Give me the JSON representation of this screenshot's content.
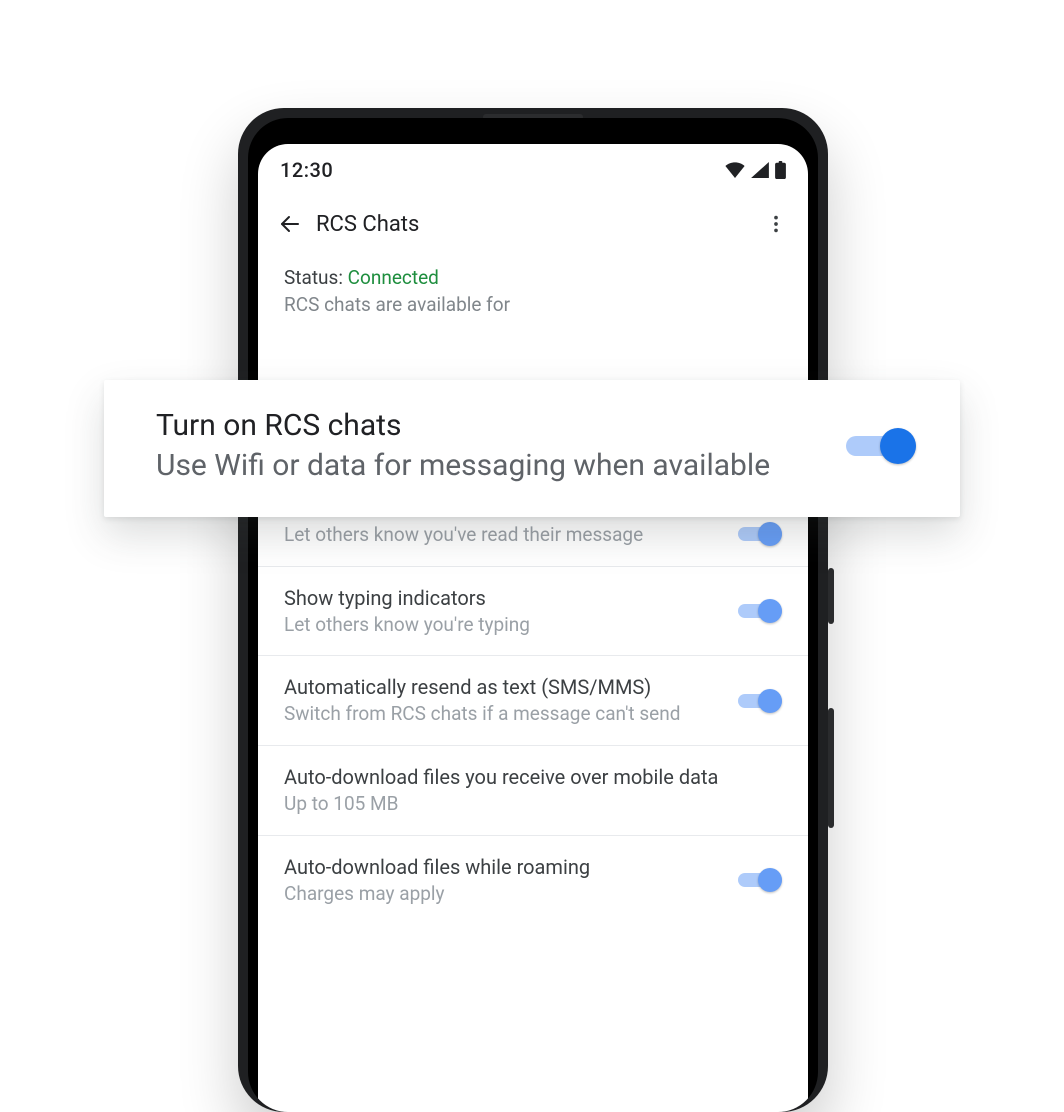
{
  "statusbar": {
    "time": "12:30"
  },
  "appbar": {
    "title": "RCS Chats"
  },
  "status": {
    "label": "Status: ",
    "value": "Connected",
    "subtitle": "RCS chats are available for"
  },
  "highlight": {
    "title": "Turn on RCS chats",
    "subtitle": "Use Wifi or data for messaging when available",
    "enabled": true
  },
  "rows": {
    "readReceipts": {
      "subtitle": "Let others know you've read their message"
    },
    "typing": {
      "title": "Show typing indicators",
      "subtitle": "Let others know you're typing"
    },
    "resend": {
      "title": "Automatically resend as text (SMS/MMS)",
      "subtitle": "Switch from RCS chats if a message can't send"
    },
    "autoDownloadMobile": {
      "title": "Auto-download files you receive over mobile data",
      "subtitle": "Up to 105 MB"
    },
    "autoDownloadRoaming": {
      "title": "Auto-download files while roaming",
      "subtitle": "Charges may apply"
    }
  }
}
